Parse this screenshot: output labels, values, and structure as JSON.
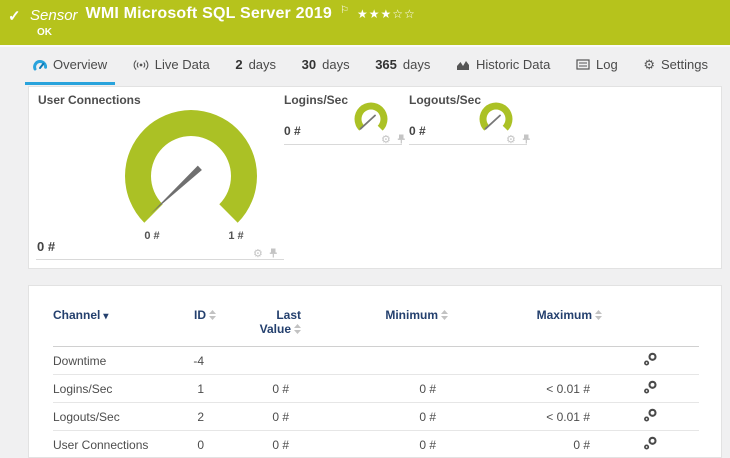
{
  "header": {
    "check_icon": "✓",
    "kind_label": "Sensor",
    "title": "WMI Microsoft SQL Server 2019",
    "flag_icon": "⚐",
    "stars_filled": "★★★",
    "stars_empty": "☆☆",
    "status": "OK",
    "bar_color": "#b6c31c"
  },
  "tabs": {
    "overview": {
      "label": "Overview"
    },
    "live_data": {
      "label": "Live Data"
    },
    "days2": {
      "num": "2",
      "label": "days"
    },
    "days30": {
      "num": "30",
      "label": "days"
    },
    "days365": {
      "num": "365",
      "label": "days"
    },
    "historic": {
      "label": "Historic Data"
    },
    "log": {
      "label": "Log"
    },
    "settings": {
      "label": "Settings",
      "gear_glyph": "⚙"
    },
    "accent_color": "#29a3dc"
  },
  "gauges": {
    "gauge_color": "#abc125",
    "needle_color": "#6f6f6f",
    "gear_glyph": "⚙",
    "user_connections": {
      "title": "User Connections",
      "value": "0 #",
      "scale_min": "0 #",
      "scale_max": "1 #"
    },
    "logins": {
      "title": "Logins/Sec",
      "value": "0 #"
    },
    "logouts": {
      "title": "Logouts/Sec",
      "value": "0 #"
    }
  },
  "table": {
    "header_text_color": "#24406e",
    "headers": {
      "channel": "Channel",
      "sort_desc_icon": "▾",
      "id": "ID",
      "last_line1": "Last",
      "last_line2": "Value",
      "minimum": "Minimum",
      "maximum": "Maximum"
    },
    "rows": [
      {
        "channel": "Downtime",
        "id": "-4",
        "last_value": "",
        "minimum": "",
        "maximum": ""
      },
      {
        "channel": "Logins/Sec",
        "id": "1",
        "last_value": "0 #",
        "minimum": "0 #",
        "maximum": "< 0.01 #"
      },
      {
        "channel": "Logouts/Sec",
        "id": "2",
        "last_value": "0 #",
        "minimum": "0 #",
        "maximum": "< 0.01 #"
      },
      {
        "channel": "User Connections",
        "id": "0",
        "last_value": "0 #",
        "minimum": "0 #",
        "maximum": "0 #"
      }
    ]
  }
}
